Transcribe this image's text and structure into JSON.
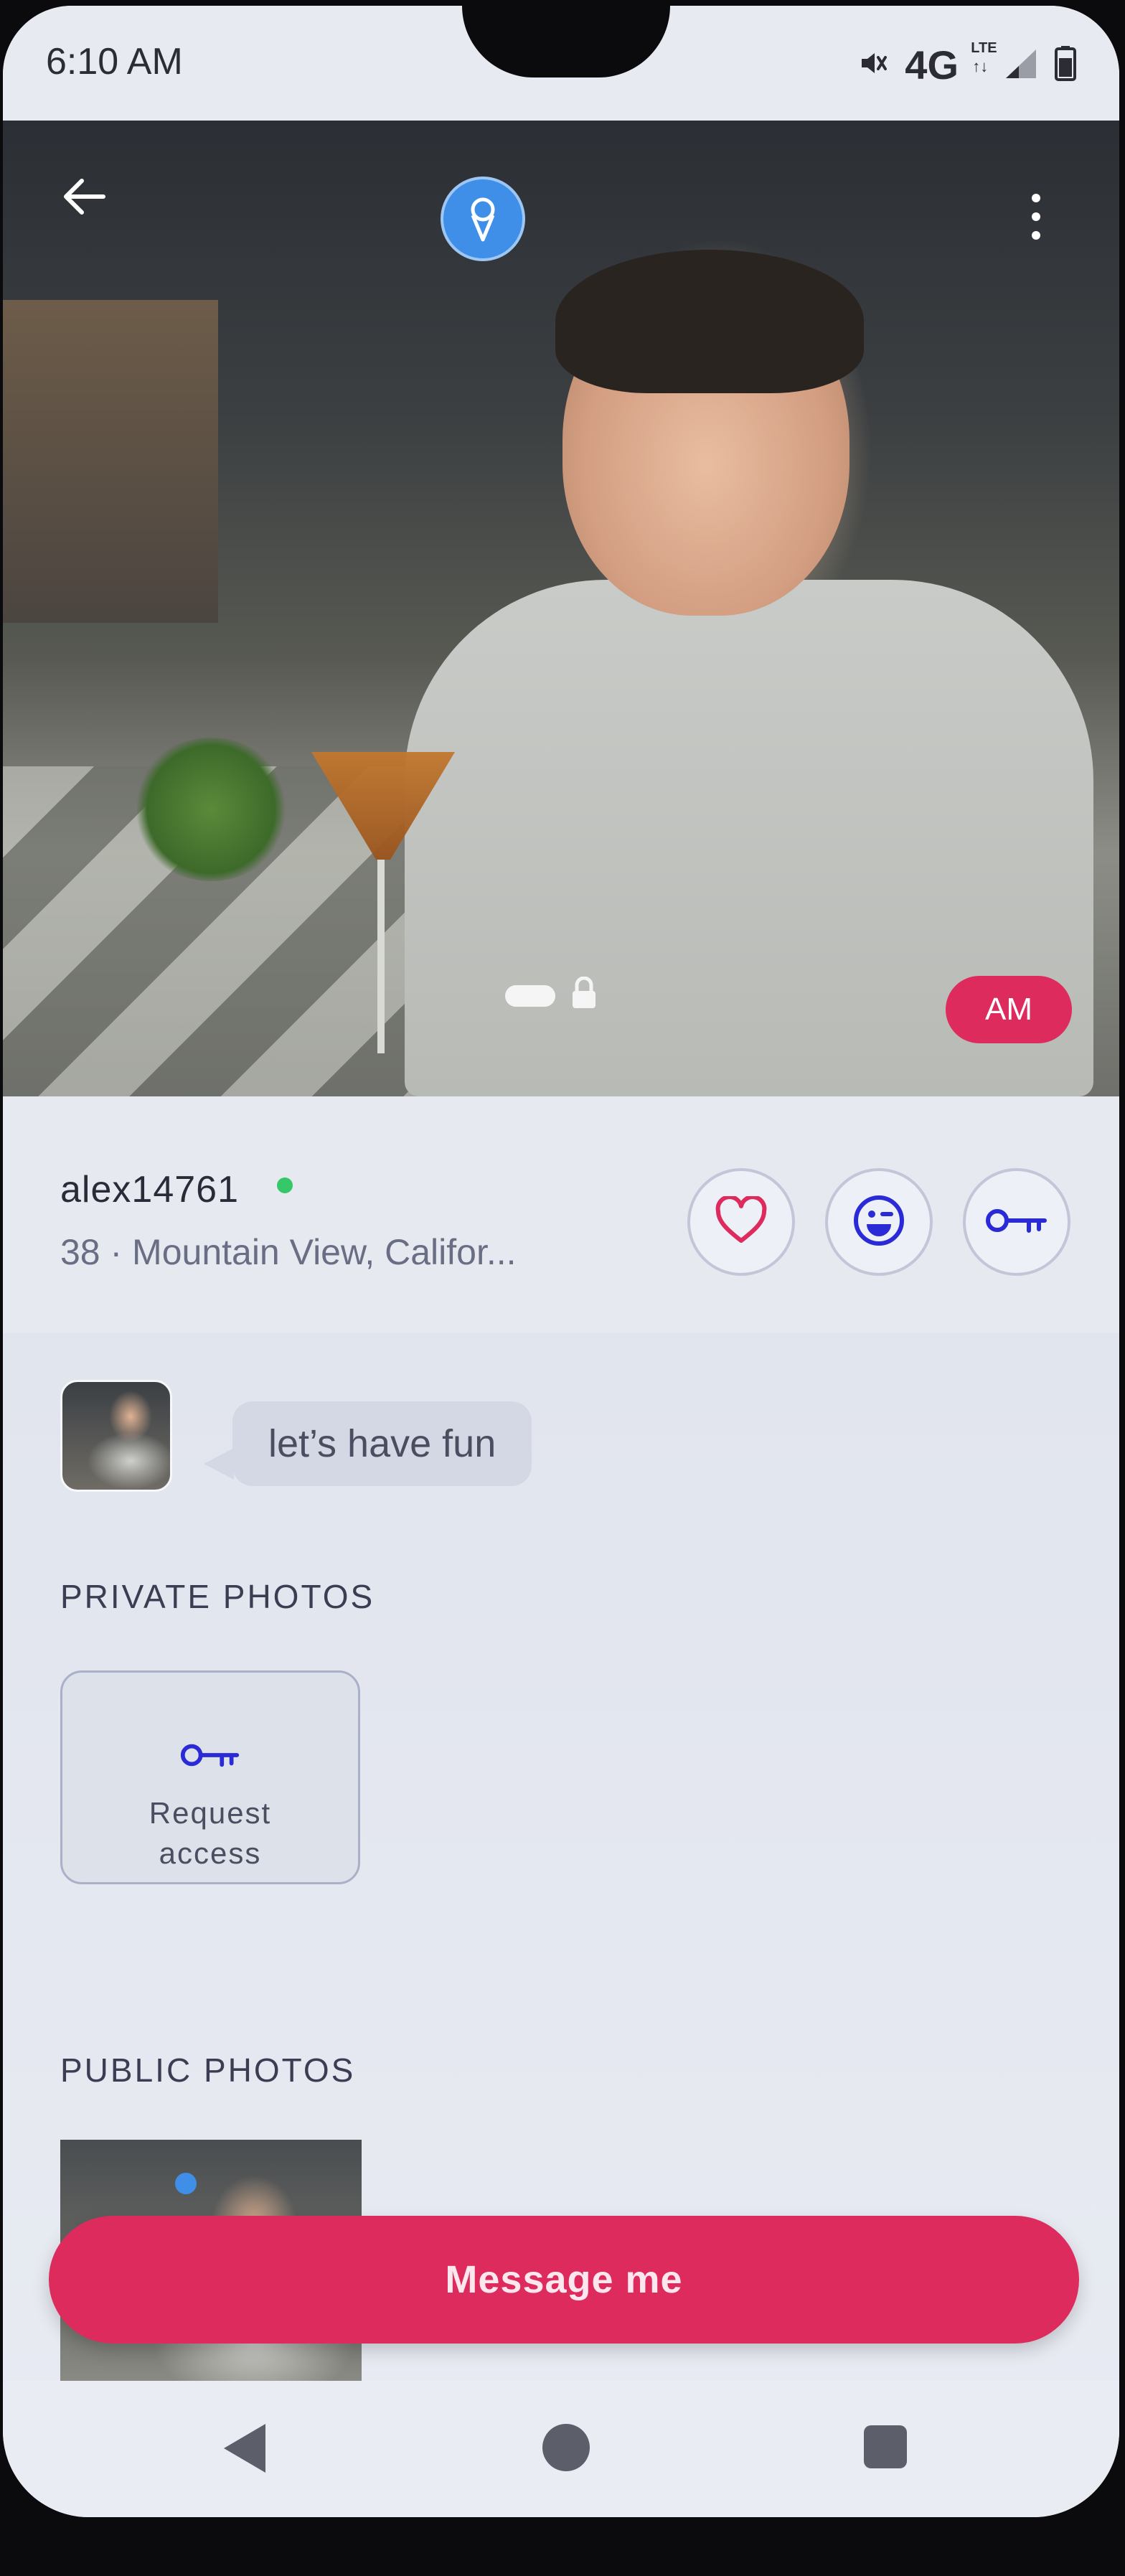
{
  "status_bar": {
    "time": "6:10 AM",
    "network": "4G",
    "network_sub": "LTE",
    "network_arrows": "↑↓",
    "icons": [
      "mute-icon",
      "signal-icon",
      "battery-icon"
    ]
  },
  "hero": {
    "tag": "AM",
    "icons": [
      "back-arrow-icon",
      "ice-cream-badge-icon",
      "more-vertical-icon",
      "lock-icon"
    ]
  },
  "profile": {
    "username": "alex14761",
    "online": true,
    "subline": "38 · Mountain View, Califor...",
    "actions": [
      "heart-icon",
      "wink-face-icon",
      "key-icon"
    ]
  },
  "about": {
    "bubble_text": "let’s have fun"
  },
  "private_photos": {
    "title": "PRIVATE PHOTOS",
    "request_line1": "Request",
    "request_line2": "access"
  },
  "public_photos": {
    "title": "PUBLIC PHOTOS"
  },
  "cta": {
    "label": "Message me"
  },
  "colors": {
    "accent": "#dd2b5d",
    "icon_blue": "#2a2ad6",
    "online_green": "#35c768"
  }
}
